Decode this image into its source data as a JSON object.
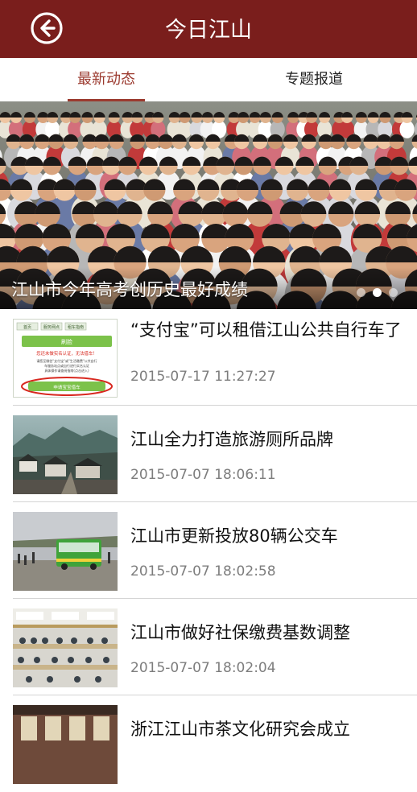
{
  "header": {
    "title": "今日江山",
    "back_icon": "arrow-left-circle-icon"
  },
  "tabs": [
    {
      "label": "最新动态",
      "active": true
    },
    {
      "label": "专题报道",
      "active": false
    }
  ],
  "banner": {
    "caption": "江山市今年高考创历史最好成绩",
    "slides": 3,
    "active_slide": 2
  },
  "news": [
    {
      "title": "“支付宝”可以租借江山公共自行车了",
      "time": "2015-07-17 11:27:27"
    },
    {
      "title": "江山全力打造旅游厕所品牌",
      "time": "2015-07-07 18:06:11"
    },
    {
      "title": "江山市更新投放80辆公交车",
      "time": "2015-07-07 18:02:58"
    },
    {
      "title": "江山市做好社保缴费基数调整",
      "time": "2015-07-07 18:02:04"
    },
    {
      "title": "浙江江山市茶文化研究会成立",
      "time": ""
    }
  ],
  "thumb1": {
    "tabs": [
      "首页",
      "服务网点",
      "租车指南"
    ],
    "button_label": "刷脸",
    "warning": "您还未做实名认证，无法借车！",
    "notice_line1": "请您至微信\"支付宝\"或\"生活缴费\"公共自行",
    "notice_line2": "车服务站点或自行进行实名认证",
    "notice_line3": "具体操作请查阅指南(点击进入)",
    "cta": "申请宝宝借车"
  },
  "colors": {
    "header_bg": "#7a1e1c",
    "accent": "#9b3a2f"
  }
}
